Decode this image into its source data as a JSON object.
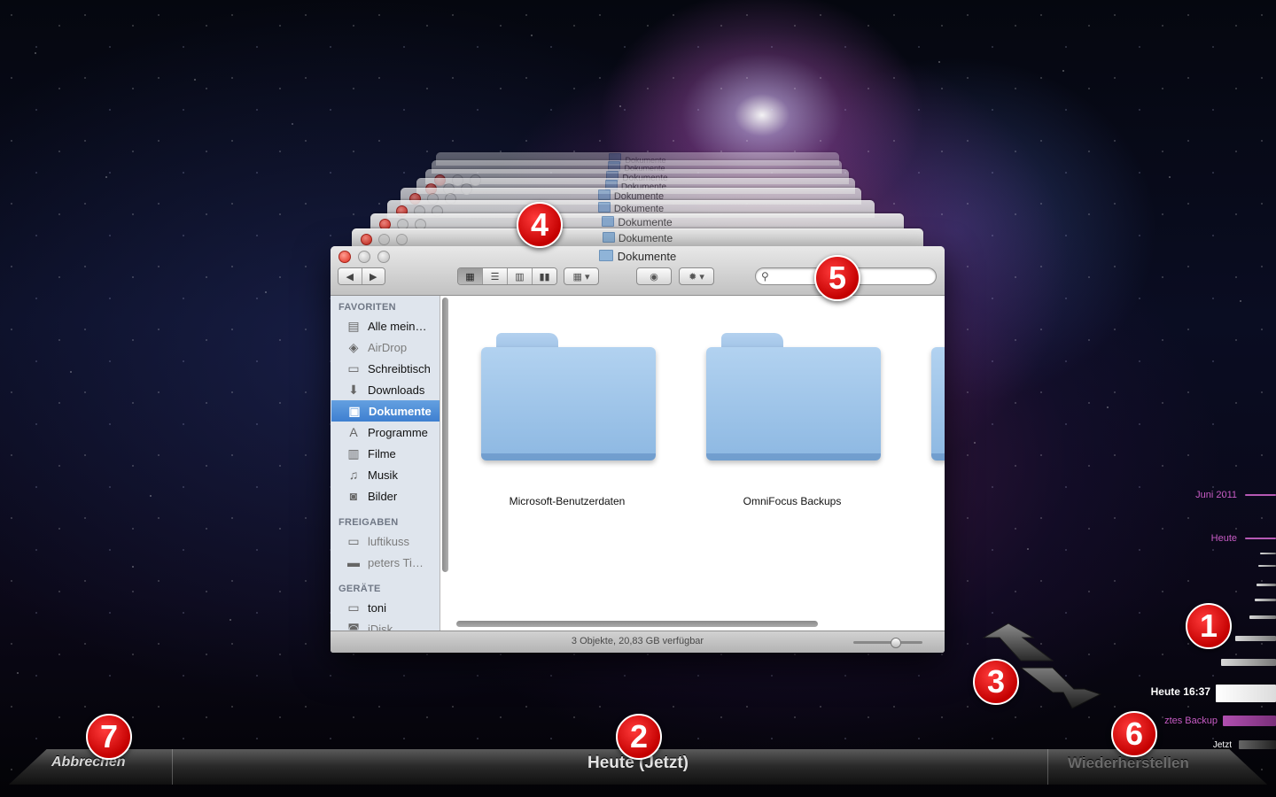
{
  "window": {
    "title": "Dokumente",
    "backdrop_title": "Dokumente"
  },
  "toolbar": {
    "back_icon": "back-arrow-icon",
    "forward_icon": "forward-arrow-icon",
    "view_modes": [
      "icon-view",
      "list-view",
      "column-view",
      "coverflow-view"
    ],
    "selected_view": "icon-view",
    "arrange_icon": "arrange-grid-icon",
    "quicklook_icon": "eye-icon",
    "action_icon": "gear-icon",
    "search_placeholder": ""
  },
  "sidebar": {
    "sections": [
      {
        "header": "FAVORITEN",
        "items": [
          {
            "label": "Alle mein…",
            "icon": "documents-icon",
            "dim": false
          },
          {
            "label": "AirDrop",
            "icon": "airdrop-icon",
            "dim": true
          },
          {
            "label": "Schreibtisch",
            "icon": "desktop-icon",
            "dim": false
          },
          {
            "label": "Downloads",
            "icon": "downloads-icon",
            "dim": false
          },
          {
            "label": "Dokumente",
            "icon": "document-icon",
            "dim": false,
            "selected": true
          },
          {
            "label": "Programme",
            "icon": "applications-icon",
            "dim": false
          },
          {
            "label": "Filme",
            "icon": "film-icon",
            "dim": false
          },
          {
            "label": "Musik",
            "icon": "music-icon",
            "dim": false
          },
          {
            "label": "Bilder",
            "icon": "camera-icon",
            "dim": false
          }
        ]
      },
      {
        "header": "FREIGABEN",
        "items": [
          {
            "label": "luftikuss",
            "icon": "computer-icon",
            "dim": true
          },
          {
            "label": "peters Ti…",
            "icon": "disk-icon",
            "dim": true
          }
        ]
      },
      {
        "header": "GERÄTE",
        "items": [
          {
            "label": "toni",
            "icon": "computer-icon",
            "dim": false
          },
          {
            "label": "iDisk",
            "icon": "idisk-icon",
            "dim": true
          }
        ]
      }
    ]
  },
  "content": {
    "folders": [
      "Microsoft-Benutzerdaten",
      "OmniFocus Backups"
    ]
  },
  "status": {
    "text": "3 Objekte, 20,83 GB verfügbar",
    "icon_size_fraction": 0.6
  },
  "timeline": {
    "labels": [
      "Juni 2011",
      "Heute",
      "Heute 16:37",
      "ztes Backup",
      "Jetzt"
    ]
  },
  "bottombar": {
    "cancel": "Abbrechen",
    "center": "Heute (Jetzt)",
    "restore": "Wiederherstellen"
  },
  "callouts": [
    "1",
    "2",
    "3",
    "4",
    "5",
    "6",
    "7"
  ],
  "colors": {
    "accent_selection": "#3e7fd0",
    "timeline_accent": "#c75bc4",
    "callout_red": "#c40000"
  }
}
